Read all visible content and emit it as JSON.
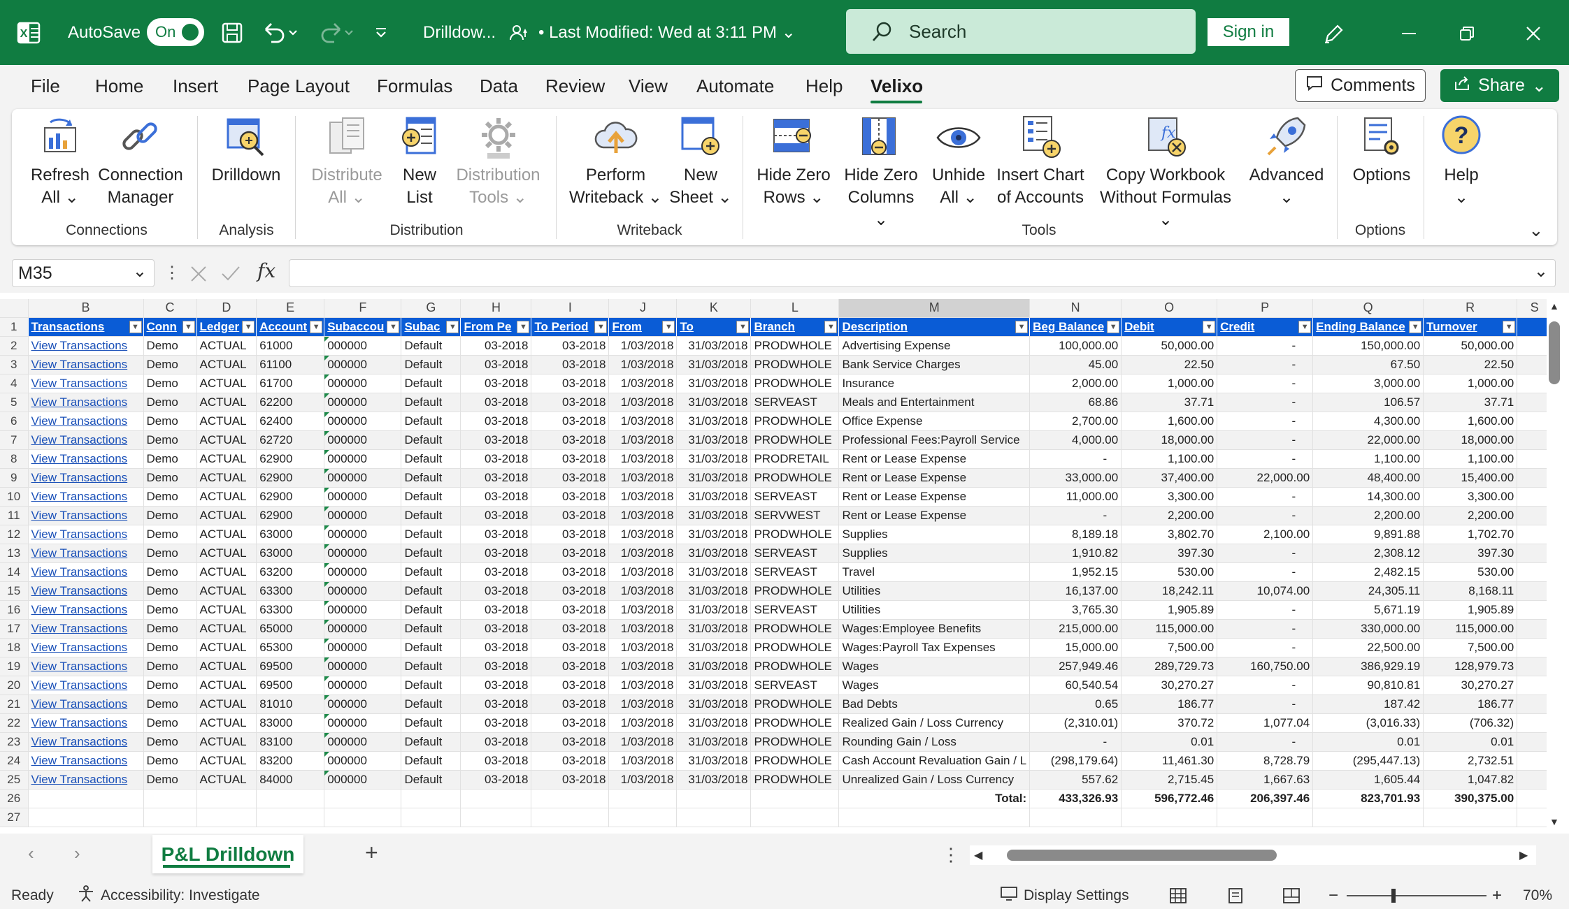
{
  "titlebar": {
    "autosave_label": "AutoSave",
    "autosave_state": "On",
    "filename": "Drilldow...",
    "last_modified": "Last Modified: Wed at 3:11 PM",
    "search_placeholder": "Search",
    "signin_label": "Sign in"
  },
  "menu": {
    "items": [
      "File",
      "Home",
      "Insert",
      "Page Layout",
      "Formulas",
      "Data",
      "Review",
      "View",
      "Automate",
      "Help",
      "Velixo"
    ],
    "active": "Velixo",
    "comments_label": "Comments",
    "share_label": "Share"
  },
  "ribbon": {
    "buttons": {
      "refresh": [
        "Refresh",
        "All ⌄"
      ],
      "connection": [
        "Connection",
        "Manager"
      ],
      "drilldown": [
        "Drilldown"
      ],
      "distribute": [
        "Distribute",
        "All ⌄"
      ],
      "newlist": [
        "New",
        "List"
      ],
      "disttools": [
        "Distribution",
        "Tools ⌄"
      ],
      "writeback": [
        "Perform",
        "Writeback ⌄"
      ],
      "newsheet": [
        "New",
        "Sheet ⌄"
      ],
      "hiderows": [
        "Hide Zero",
        "Rows ⌄"
      ],
      "hidecols": [
        "Hide Zero",
        "Columns ⌄"
      ],
      "unhide": [
        "Unhide",
        "All ⌄"
      ],
      "chart": [
        "Insert Chart",
        "of Accounts"
      ],
      "copywb": [
        "Copy Workbook",
        "Without Formulas ⌄"
      ],
      "advanced": [
        "Advanced",
        "⌄"
      ],
      "options": [
        "Options"
      ],
      "help": [
        "Help",
        "⌄"
      ]
    },
    "groups": {
      "connections": "Connections",
      "analysis": "Analysis",
      "distribution": "Distribution",
      "writeback": "Writeback",
      "tools": "Tools",
      "options": "Options"
    }
  },
  "formula": {
    "namebox": "M35",
    "fx": "fx",
    "content": ""
  },
  "sheet": {
    "columns": [
      "B",
      "C",
      "D",
      "E",
      "F",
      "G",
      "H",
      "I",
      "J",
      "K",
      "L",
      "M",
      "N",
      "O",
      "P",
      "Q",
      "R",
      "S"
    ],
    "selected_column": "M",
    "headers": [
      "Transactions",
      "Conn",
      "Ledger",
      "Account",
      "Subaccou",
      "Subac",
      "From Pe",
      "To Period",
      "From",
      "To",
      "Branch",
      "Description",
      "Beg Balance",
      "Debit",
      "Credit",
      "Ending Balance",
      "Turnover"
    ],
    "rows": [
      [
        "View Transactions",
        "Demo",
        "ACTUAL",
        "61000",
        "000000",
        "Default",
        "03-2018",
        "03-2018",
        "1/03/2018",
        "31/03/2018",
        "PRODWHOLE",
        "Advertising Expense",
        "100,000.00",
        "50,000.00",
        "-",
        "150,000.00",
        "50,000.00"
      ],
      [
        "View Transactions",
        "Demo",
        "ACTUAL",
        "61100",
        "000000",
        "Default",
        "03-2018",
        "03-2018",
        "1/03/2018",
        "31/03/2018",
        "PRODWHOLE",
        "Bank Service Charges",
        "45.00",
        "22.50",
        "-",
        "67.50",
        "22.50"
      ],
      [
        "View Transactions",
        "Demo",
        "ACTUAL",
        "61700",
        "000000",
        "Default",
        "03-2018",
        "03-2018",
        "1/03/2018",
        "31/03/2018",
        "PRODWHOLE",
        "Insurance",
        "2,000.00",
        "1,000.00",
        "-",
        "3,000.00",
        "1,000.00"
      ],
      [
        "View Transactions",
        "Demo",
        "ACTUAL",
        "62200",
        "000000",
        "Default",
        "03-2018",
        "03-2018",
        "1/03/2018",
        "31/03/2018",
        "SERVEAST",
        "Meals and Entertainment",
        "68.86",
        "37.71",
        "-",
        "106.57",
        "37.71"
      ],
      [
        "View Transactions",
        "Demo",
        "ACTUAL",
        "62400",
        "000000",
        "Default",
        "03-2018",
        "03-2018",
        "1/03/2018",
        "31/03/2018",
        "PRODWHOLE",
        "Office Expense",
        "2,700.00",
        "1,600.00",
        "-",
        "4,300.00",
        "1,600.00"
      ],
      [
        "View Transactions",
        "Demo",
        "ACTUAL",
        "62720",
        "000000",
        "Default",
        "03-2018",
        "03-2018",
        "1/03/2018",
        "31/03/2018",
        "PRODWHOLE",
        "Professional Fees:Payroll Service",
        "4,000.00",
        "18,000.00",
        "-",
        "22,000.00",
        "18,000.00"
      ],
      [
        "View Transactions",
        "Demo",
        "ACTUAL",
        "62900",
        "000000",
        "Default",
        "03-2018",
        "03-2018",
        "1/03/2018",
        "31/03/2018",
        "PRODRETAIL",
        "Rent or Lease Expense",
        "-",
        "1,100.00",
        "-",
        "1,100.00",
        "1,100.00"
      ],
      [
        "View Transactions",
        "Demo",
        "ACTUAL",
        "62900",
        "000000",
        "Default",
        "03-2018",
        "03-2018",
        "1/03/2018",
        "31/03/2018",
        "PRODWHOLE",
        "Rent or Lease Expense",
        "33,000.00",
        "37,400.00",
        "22,000.00",
        "48,400.00",
        "15,400.00"
      ],
      [
        "View Transactions",
        "Demo",
        "ACTUAL",
        "62900",
        "000000",
        "Default",
        "03-2018",
        "03-2018",
        "1/03/2018",
        "31/03/2018",
        "SERVEAST",
        "Rent or Lease Expense",
        "11,000.00",
        "3,300.00",
        "-",
        "14,300.00",
        "3,300.00"
      ],
      [
        "View Transactions",
        "Demo",
        "ACTUAL",
        "62900",
        "000000",
        "Default",
        "03-2018",
        "03-2018",
        "1/03/2018",
        "31/03/2018",
        "SERVWEST",
        "Rent or Lease Expense",
        "-",
        "2,200.00",
        "-",
        "2,200.00",
        "2,200.00"
      ],
      [
        "View Transactions",
        "Demo",
        "ACTUAL",
        "63000",
        "000000",
        "Default",
        "03-2018",
        "03-2018",
        "1/03/2018",
        "31/03/2018",
        "PRODWHOLE",
        "Supplies",
        "8,189.18",
        "3,802.70",
        "2,100.00",
        "9,891.88",
        "1,702.70"
      ],
      [
        "View Transactions",
        "Demo",
        "ACTUAL",
        "63000",
        "000000",
        "Default",
        "03-2018",
        "03-2018",
        "1/03/2018",
        "31/03/2018",
        "SERVEAST",
        "Supplies",
        "1,910.82",
        "397.30",
        "-",
        "2,308.12",
        "397.30"
      ],
      [
        "View Transactions",
        "Demo",
        "ACTUAL",
        "63200",
        "000000",
        "Default",
        "03-2018",
        "03-2018",
        "1/03/2018",
        "31/03/2018",
        "SERVEAST",
        "Travel",
        "1,952.15",
        "530.00",
        "-",
        "2,482.15",
        "530.00"
      ],
      [
        "View Transactions",
        "Demo",
        "ACTUAL",
        "63300",
        "000000",
        "Default",
        "03-2018",
        "03-2018",
        "1/03/2018",
        "31/03/2018",
        "PRODWHOLE",
        "Utilities",
        "16,137.00",
        "18,242.11",
        "10,074.00",
        "24,305.11",
        "8,168.11"
      ],
      [
        "View Transactions",
        "Demo",
        "ACTUAL",
        "63300",
        "000000",
        "Default",
        "03-2018",
        "03-2018",
        "1/03/2018",
        "31/03/2018",
        "SERVEAST",
        "Utilities",
        "3,765.30",
        "1,905.89",
        "-",
        "5,671.19",
        "1,905.89"
      ],
      [
        "View Transactions",
        "Demo",
        "ACTUAL",
        "65000",
        "000000",
        "Default",
        "03-2018",
        "03-2018",
        "1/03/2018",
        "31/03/2018",
        "PRODWHOLE",
        "Wages:Employee Benefits",
        "215,000.00",
        "115,000.00",
        "-",
        "330,000.00",
        "115,000.00"
      ],
      [
        "View Transactions",
        "Demo",
        "ACTUAL",
        "65300",
        "000000",
        "Default",
        "03-2018",
        "03-2018",
        "1/03/2018",
        "31/03/2018",
        "PRODWHOLE",
        "Wages:Payroll Tax Expenses",
        "15,000.00",
        "7,500.00",
        "-",
        "22,500.00",
        "7,500.00"
      ],
      [
        "View Transactions",
        "Demo",
        "ACTUAL",
        "69500",
        "000000",
        "Default",
        "03-2018",
        "03-2018",
        "1/03/2018",
        "31/03/2018",
        "PRODWHOLE",
        "Wages",
        "257,949.46",
        "289,729.73",
        "160,750.00",
        "386,929.19",
        "128,979.73"
      ],
      [
        "View Transactions",
        "Demo",
        "ACTUAL",
        "69500",
        "000000",
        "Default",
        "03-2018",
        "03-2018",
        "1/03/2018",
        "31/03/2018",
        "SERVEAST",
        "Wages",
        "60,540.54",
        "30,270.27",
        "-",
        "90,810.81",
        "30,270.27"
      ],
      [
        "View Transactions",
        "Demo",
        "ACTUAL",
        "81010",
        "000000",
        "Default",
        "03-2018",
        "03-2018",
        "1/03/2018",
        "31/03/2018",
        "PRODWHOLE",
        "Bad Debts",
        "0.65",
        "186.77",
        "-",
        "187.42",
        "186.77"
      ],
      [
        "View Transactions",
        "Demo",
        "ACTUAL",
        "83000",
        "000000",
        "Default",
        "03-2018",
        "03-2018",
        "1/03/2018",
        "31/03/2018",
        "PRODWHOLE",
        "Realized Gain / Loss Currency",
        "(2,310.01)",
        "370.72",
        "1,077.04",
        "(3,016.33)",
        "(706.32)"
      ],
      [
        "View Transactions",
        "Demo",
        "ACTUAL",
        "83100",
        "000000",
        "Default",
        "03-2018",
        "03-2018",
        "1/03/2018",
        "31/03/2018",
        "PRODWHOLE",
        "Rounding Gain / Loss",
        "-",
        "0.01",
        "-",
        "0.01",
        "0.01"
      ],
      [
        "View Transactions",
        "Demo",
        "ACTUAL",
        "83200",
        "000000",
        "Default",
        "03-2018",
        "03-2018",
        "1/03/2018",
        "31/03/2018",
        "PRODWHOLE",
        "Cash Account Revaluation Gain / L",
        "(298,179.64)",
        "11,461.30",
        "8,728.79",
        "(295,447.13)",
        "2,732.51"
      ],
      [
        "View Transactions",
        "Demo",
        "ACTUAL",
        "84000",
        "000000",
        "Default",
        "03-2018",
        "03-2018",
        "1/03/2018",
        "31/03/2018",
        "PRODWHOLE",
        "Unrealized Gain / Loss Currency",
        "557.62",
        "2,715.45",
        "1,667.63",
        "1,605.44",
        "1,047.82"
      ]
    ],
    "total": {
      "label": "Total:",
      "values": [
        "433,326.93",
        "596,772.46",
        "206,397.46",
        "823,701.93",
        "390,375.00"
      ]
    }
  },
  "tabs": {
    "sheet_name": "P&L Drilldown",
    "add": "+"
  },
  "status": {
    "ready": "Ready",
    "accessibility": "Accessibility: Investigate",
    "display_settings": "Display Settings",
    "zoom": "70%"
  },
  "colors": {
    "excel_green": "#107c41",
    "header_blue": "#0a5cd6",
    "link_blue": "#1a50b8"
  }
}
